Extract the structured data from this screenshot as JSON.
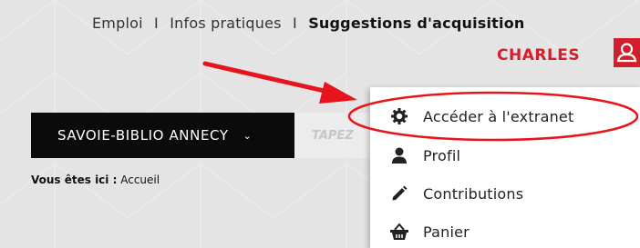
{
  "topnav": {
    "items": [
      "Emploi",
      "Infos pratiques",
      "Suggestions d'acquisition"
    ],
    "separator": "I"
  },
  "user": {
    "name": "CHARLES",
    "icon": "user-outline-icon",
    "accent": "#d21f2b"
  },
  "library_select": {
    "value": "SAVOIE-BIBLIO ANNECY",
    "chevron": "⌄"
  },
  "search": {
    "placeholder": "TAPEZ"
  },
  "breadcrumb": {
    "label": "Vous êtes ici :",
    "current": "Accueil"
  },
  "dropdown": {
    "items": [
      {
        "label": "Accéder à l'extranet",
        "icon": "gear-icon"
      },
      {
        "label": "Profil",
        "icon": "person-icon"
      },
      {
        "label": "Contributions",
        "icon": "pencil-icon"
      },
      {
        "label": "Panier",
        "icon": "basket-icon"
      }
    ]
  },
  "annotation": {
    "color": "#e8141c"
  }
}
